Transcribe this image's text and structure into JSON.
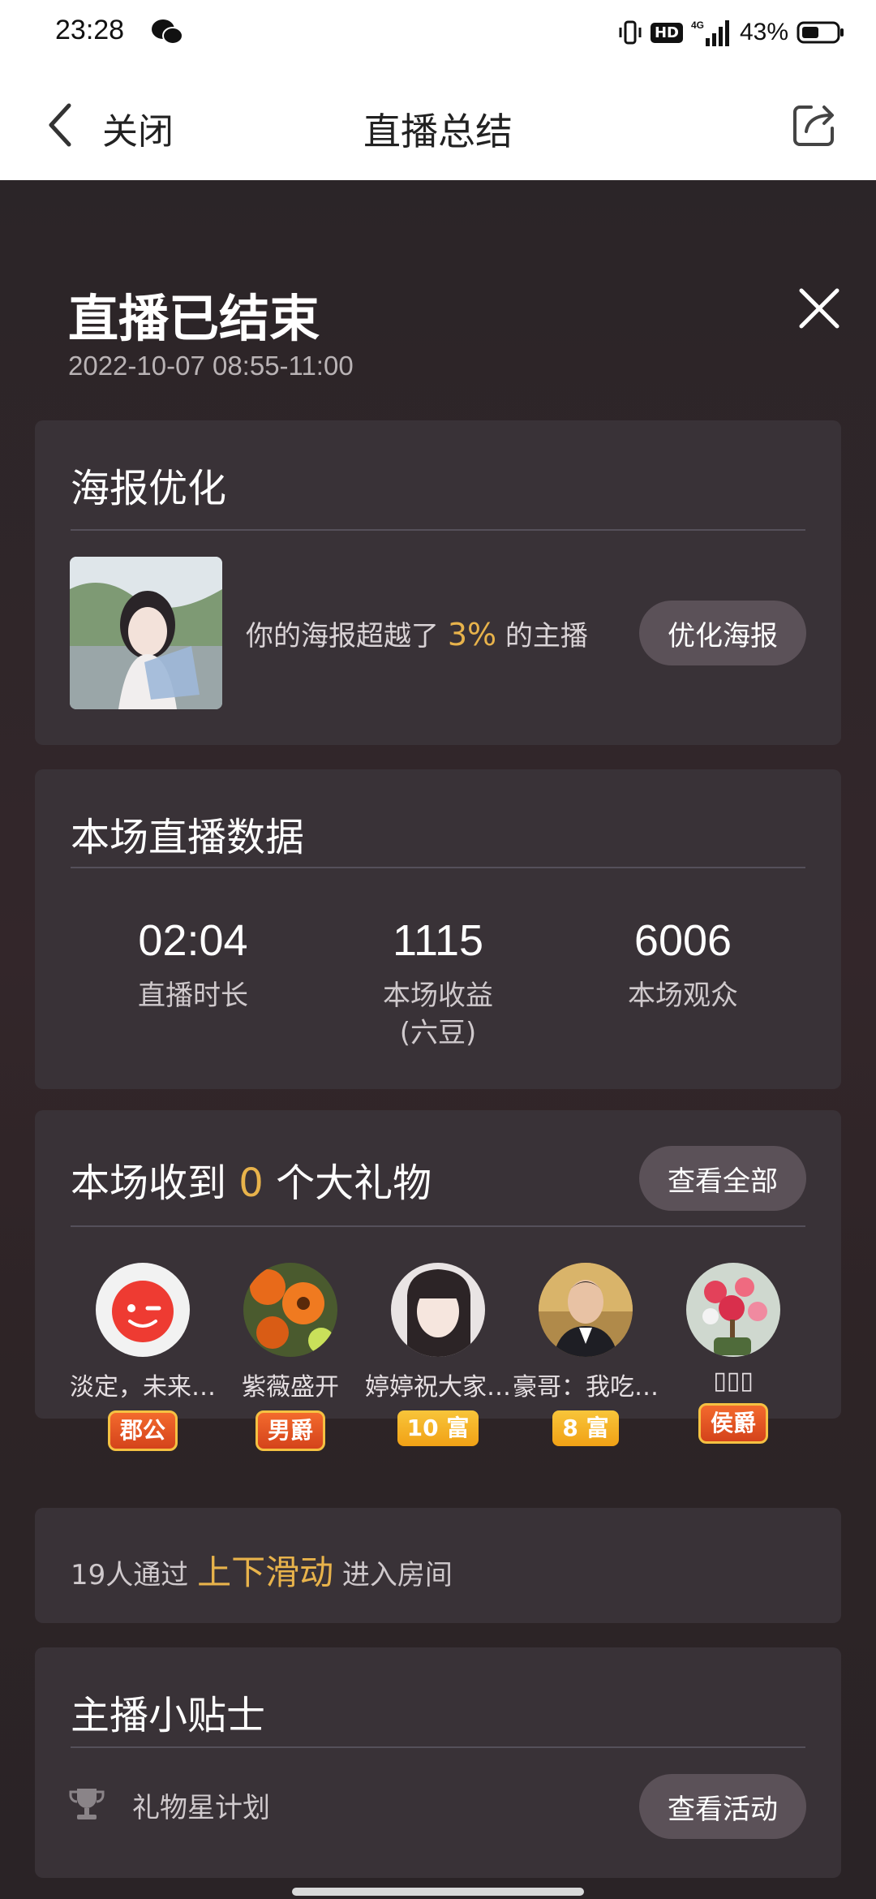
{
  "status": {
    "time": "23:28",
    "battery": "43%",
    "hd": "HD",
    "net": "4G"
  },
  "nav": {
    "close": "关闭",
    "title": "直播总结"
  },
  "summary": {
    "title": "直播已结束",
    "time": "2022-10-07 08:55-11:00"
  },
  "poster": {
    "title": "海报优化",
    "text_pre": "你的海报超越了 ",
    "percent": "3%",
    "text_post": " 的主播",
    "button": "优化海报"
  },
  "stats": {
    "title": "本场直播数据",
    "items": [
      {
        "value": "02:04",
        "label": "直播时长",
        "sub": ""
      },
      {
        "value": "1115",
        "label": "本场收益",
        "sub": "(六豆)"
      },
      {
        "value": "6006",
        "label": "本场观众",
        "sub": ""
      }
    ]
  },
  "gifts": {
    "title_pre": "本场收到 ",
    "count": "0",
    "title_post": " 个大礼物",
    "button": "查看全部",
    "users": [
      {
        "name": "淡定，未来…",
        "badge": "郡公",
        "badge_type": "rank"
      },
      {
        "name": "紫薇盛开",
        "badge": "男爵",
        "badge_type": "rank"
      },
      {
        "name": "婷婷祝大家…",
        "badge": "10 富",
        "badge_type": "rich"
      },
      {
        "name": "豪哥：我吃…",
        "badge": "8 富",
        "badge_type": "rich"
      },
      {
        "name": "▯▯▯",
        "badge": "侯爵",
        "badge_type": "rank"
      }
    ]
  },
  "swipe": {
    "count_text": "19人通过 ",
    "action": "上下滑动",
    "suffix": " 进入房间"
  },
  "tips": {
    "title": "主播小贴士",
    "item": "礼物星计划",
    "button": "查看活动"
  },
  "colors": {
    "accent": "#e8b34b",
    "card": "#393237",
    "pill": "#5b5158"
  }
}
